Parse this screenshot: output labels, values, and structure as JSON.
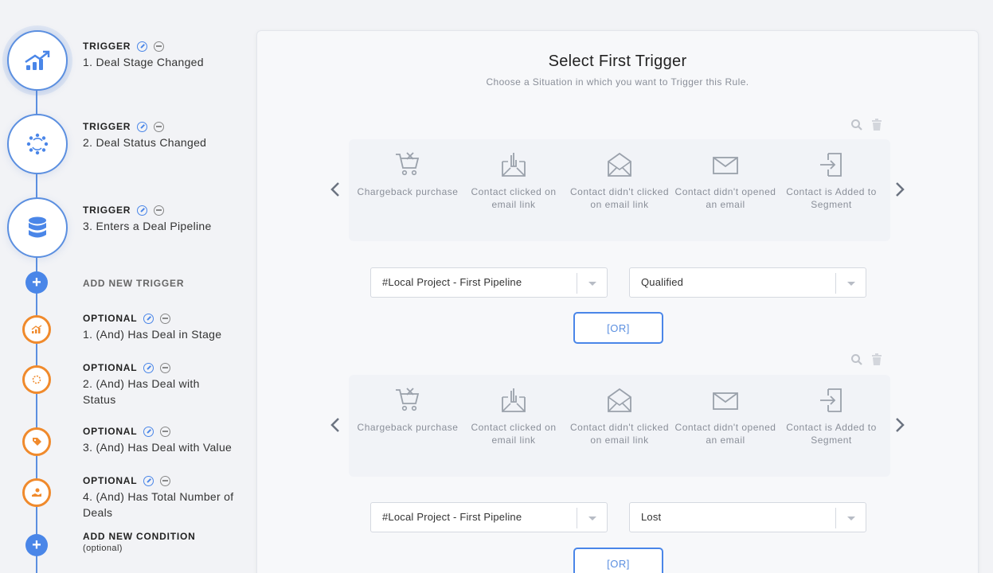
{
  "sidebar": {
    "triggers": [
      {
        "kind": "TRIGGER",
        "title": "1. Deal Stage Changed",
        "icon": "chart-up-icon"
      },
      {
        "kind": "TRIGGER",
        "title": "2. Deal Status Changed",
        "icon": "refresh-dots-icon"
      },
      {
        "kind": "TRIGGER",
        "title": "3. Enters a Deal Pipeline",
        "icon": "database-icon"
      }
    ],
    "add_trigger_label": "ADD NEW TRIGGER",
    "conditions": [
      {
        "kind": "OPTIONAL",
        "title": "1. (And) Has Deal in Stage",
        "icon": "chart-up-icon"
      },
      {
        "kind": "OPTIONAL",
        "title": "2. (And) Has Deal with Status",
        "icon": "refresh-dots-icon"
      },
      {
        "kind": "OPTIONAL",
        "title": "3. (And) Has Deal with Value",
        "icon": "tag-icon"
      },
      {
        "kind": "OPTIONAL",
        "title": "4. (And) Has Total Number of Deals",
        "icon": "hand-coin-icon"
      }
    ],
    "add_condition_label": "ADD NEW CONDITION",
    "add_condition_sub": "(optional)"
  },
  "main": {
    "title": "Select First Trigger",
    "subtitle": "Choose a Situation in which you want to Trigger this Rule.",
    "or_label": "[OR]",
    "cards": [
      {
        "label": "Chargeback purchase",
        "icon": "cart-x-icon"
      },
      {
        "label": "Contact clicked on email link",
        "icon": "inbox-click-icon"
      },
      {
        "label": "Contact didn't clicked on email link",
        "icon": "envelope-open-icon"
      },
      {
        "label": "Contact didn't opened an email",
        "icon": "envelope-icon"
      },
      {
        "label": "Contact is Added to Segment",
        "icon": "sign-in-icon"
      }
    ],
    "blocks": [
      {
        "pipeline": "#Local Project - First Pipeline",
        "stage": "Qualified"
      },
      {
        "pipeline": "#Local Project - First Pipeline",
        "stage": "Lost"
      }
    ]
  },
  "colors": {
    "accent": "#4a86e8",
    "optional": "#f08a2c"
  }
}
